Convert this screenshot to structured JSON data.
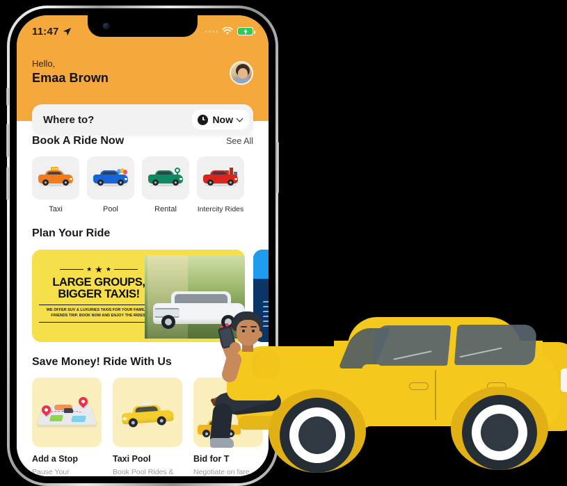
{
  "statusbar": {
    "time": "11:47",
    "location_icon": "location-arrow-icon",
    "signal_icon": "signal-dots-icon",
    "wifi_icon": "wifi-icon",
    "battery_icon": "battery-charging-icon"
  },
  "header": {
    "greeting": "Hello,",
    "user_name": "Emaa Brown",
    "avatar_label": "avatar",
    "accent_color": "#F5A83C"
  },
  "search": {
    "placeholder": "Where to?",
    "time_mode": "Now",
    "clock_icon": "clock-icon",
    "chevron_icon": "chevron-down-icon"
  },
  "book_section": {
    "title": "Book A Ride Now",
    "see_all": "See All",
    "services": [
      {
        "label": "Taxi",
        "icon": "taxi-car-icon",
        "color": "#F07C1E"
      },
      {
        "label": "Pool",
        "icon": "pool-car-icon",
        "color": "#1565D8"
      },
      {
        "label": "Rental",
        "icon": "rental-car-icon",
        "color": "#0E8A62"
      },
      {
        "label": "Intercity Rides",
        "icon": "intercity-car-icon",
        "color": "#D9251D"
      }
    ]
  },
  "plan_section": {
    "title": "Plan Your Ride",
    "banner": {
      "headline_line1": "LARGE GROUPS,",
      "headline_line2": "BIGGER TAXIS!",
      "subtext": "WE OFFER SUV & LUXURIES TAXIS FOR YOUR FAMILY & FRIENDS TRIP. BOOK NOW AND ENJOY THE RIDES!",
      "background": "#F7DF4A"
    },
    "banner_next": {
      "top_color": "#1E9CF0",
      "body_color": "#0B3566"
    }
  },
  "save_section": {
    "title": "Save Money! Ride With Us",
    "cards": [
      {
        "title": "Add a Stop",
        "subtitle": "Pause Your\nRide Anytime",
        "icon": "map-route-icon"
      },
      {
        "title": "Taxi Pool",
        "subtitle": "Book Pool Rides &\nSave More",
        "icon": "taxi-icon"
      },
      {
        "title": "Bid for T",
        "subtitle": "Negotiate on fare\nbefore booking",
        "icon": "gavel-taxi-icon"
      }
    ]
  },
  "illustration": {
    "car_label": "yellow-hatchback-car",
    "person_label": "man-sitting-with-phone",
    "car_color": "#F5C81E"
  }
}
